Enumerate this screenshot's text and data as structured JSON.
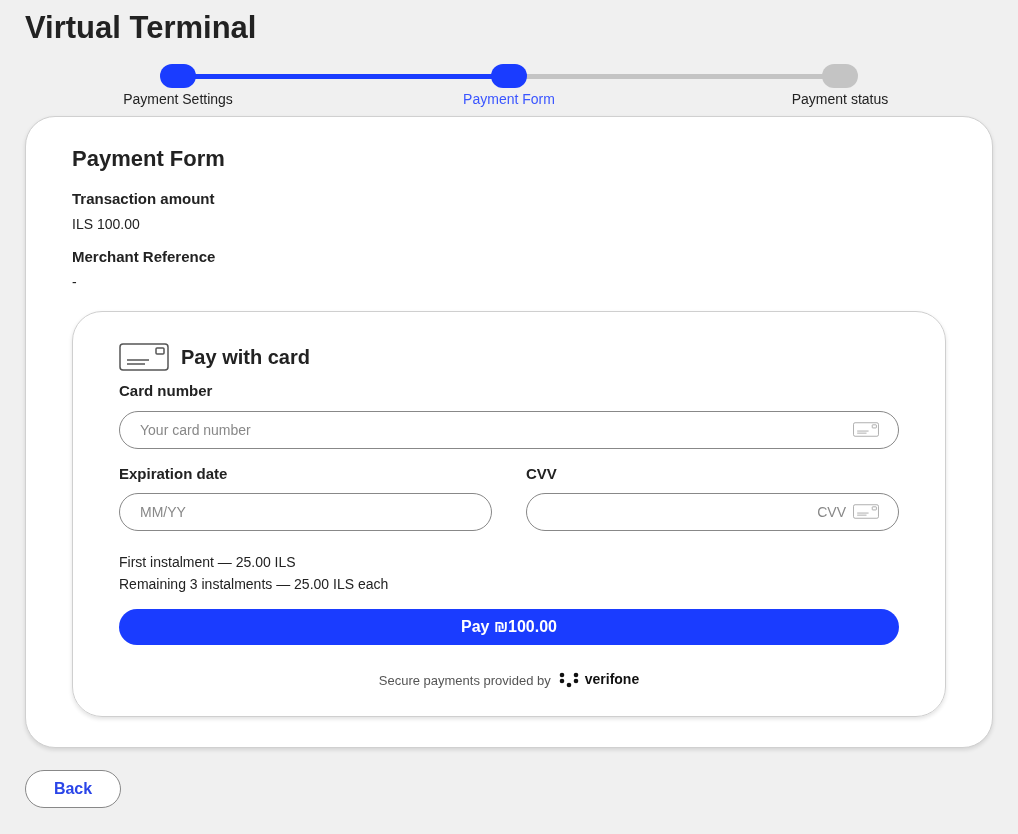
{
  "page": {
    "title": "Virtual Terminal"
  },
  "steps": [
    {
      "label": "Payment Settings",
      "kind": "done"
    },
    {
      "label": "Payment Form",
      "kind": "current"
    },
    {
      "label": "Payment status",
      "kind": "todo"
    }
  ],
  "form": {
    "title": "Payment Form",
    "details": [
      {
        "label": "Transaction amount",
        "value": "ILS 100.00"
      },
      {
        "label": "Merchant Reference",
        "value": "-"
      }
    ],
    "card": {
      "title": "Pay with card",
      "card_number": {
        "label": "Card number",
        "placeholder": "Your card number"
      },
      "expiration": {
        "label": "Expiration date",
        "placeholder": "MM/YY"
      },
      "cvv": {
        "label": "CVV",
        "placeholder": "CVV"
      },
      "instalments": [
        "First instalment — 25.00 ILS",
        "Remaining 3 instalments — 25.00 ILS each"
      ],
      "pay_button": "Pay ₪100.00",
      "footer": {
        "text": "Secure payments provided by",
        "brand": "verifone"
      }
    }
  },
  "back_button": "Back"
}
